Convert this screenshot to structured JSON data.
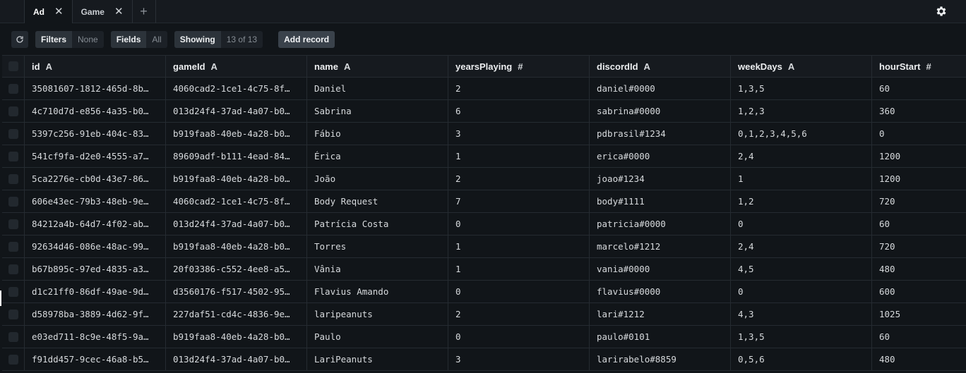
{
  "tabs": [
    {
      "label": "Ad",
      "active": true
    },
    {
      "label": "Game",
      "active": false
    }
  ],
  "tab_add_symbol": "+",
  "toolbar": {
    "filters_label": "Filters",
    "filters_value": "None",
    "fields_label": "Fields",
    "fields_value": "All",
    "showing_label": "Showing",
    "showing_value": "13 of 13",
    "add_record_label": "Add record"
  },
  "columns": [
    {
      "name": "id",
      "type": "A"
    },
    {
      "name": "gameId",
      "type": "A"
    },
    {
      "name": "name",
      "type": "A"
    },
    {
      "name": "yearsPlaying",
      "type": "#"
    },
    {
      "name": "discordId",
      "type": "A"
    },
    {
      "name": "weekDays",
      "type": "A"
    },
    {
      "name": "hourStart",
      "type": "#"
    }
  ],
  "rows": [
    [
      "35081607-1812-465d-8b…",
      "4060cad2-1ce1-4c75-8f…",
      "Daniel",
      "2",
      "daniel#0000",
      "1,3,5",
      "60"
    ],
    [
      "4c710d7d-e856-4a35-b0…",
      "013d24f4-37ad-4a07-b0…",
      "Sabrina",
      "6",
      "sabrina#0000",
      "1,2,3",
      "360"
    ],
    [
      "5397c256-91eb-404c-83…",
      "b919faa8-40eb-4a28-b0…",
      "Fábio",
      "3",
      "pdbrasil#1234",
      "0,1,2,3,4,5,6",
      "0"
    ],
    [
      "541cf9fa-d2e0-4555-a7…",
      "89609adf-b111-4ead-84…",
      "Érica",
      "1",
      "erica#0000",
      "2,4",
      "1200"
    ],
    [
      "5ca2276e-cb0d-43e7-86…",
      "b919faa8-40eb-4a28-b0…",
      "João",
      "2",
      "joao#1234",
      "1",
      "1200"
    ],
    [
      "606e43ec-79b3-48eb-9e…",
      "4060cad2-1ce1-4c75-8f…",
      "Body Request",
      "7",
      "body#1111",
      "1,2",
      "720"
    ],
    [
      "84212a4b-64d7-4f02-ab…",
      "013d24f4-37ad-4a07-b0…",
      "Patrícia Costa",
      "0",
      "patricia#0000",
      "0",
      "60"
    ],
    [
      "92634d46-086e-48ac-99…",
      "b919faa8-40eb-4a28-b0…",
      "Torres",
      "1",
      "marcelo#1212",
      "2,4",
      "720"
    ],
    [
      "b67b895c-97ed-4835-a3…",
      "20f03386-c552-4ee8-a5…",
      "Vânia",
      "1",
      "vania#0000",
      "4,5",
      "480"
    ],
    [
      "d1c21ff0-86df-49ae-9d…",
      "d3560176-f517-4502-95…",
      "Flavius Amando",
      "0",
      "flavius#0000",
      "0",
      "600"
    ],
    [
      "d58978ba-3889-4d62-9f…",
      "227daf51-cd4c-4836-9e…",
      "laripeanuts",
      "2",
      "lari#1212",
      "4,3",
      "1025"
    ],
    [
      "e03ed711-8c9e-48f5-9a…",
      "b919faa8-40eb-4a28-b0…",
      "Paulo",
      "0",
      "paulo#0101",
      "1,3,5",
      "60"
    ],
    [
      "f91dd457-9cec-46a8-b5…",
      "013d24f4-37ad-4a07-b0…",
      "LariPeanuts",
      "3",
      "larirabelo#8859",
      "0,5,6",
      "480"
    ]
  ]
}
